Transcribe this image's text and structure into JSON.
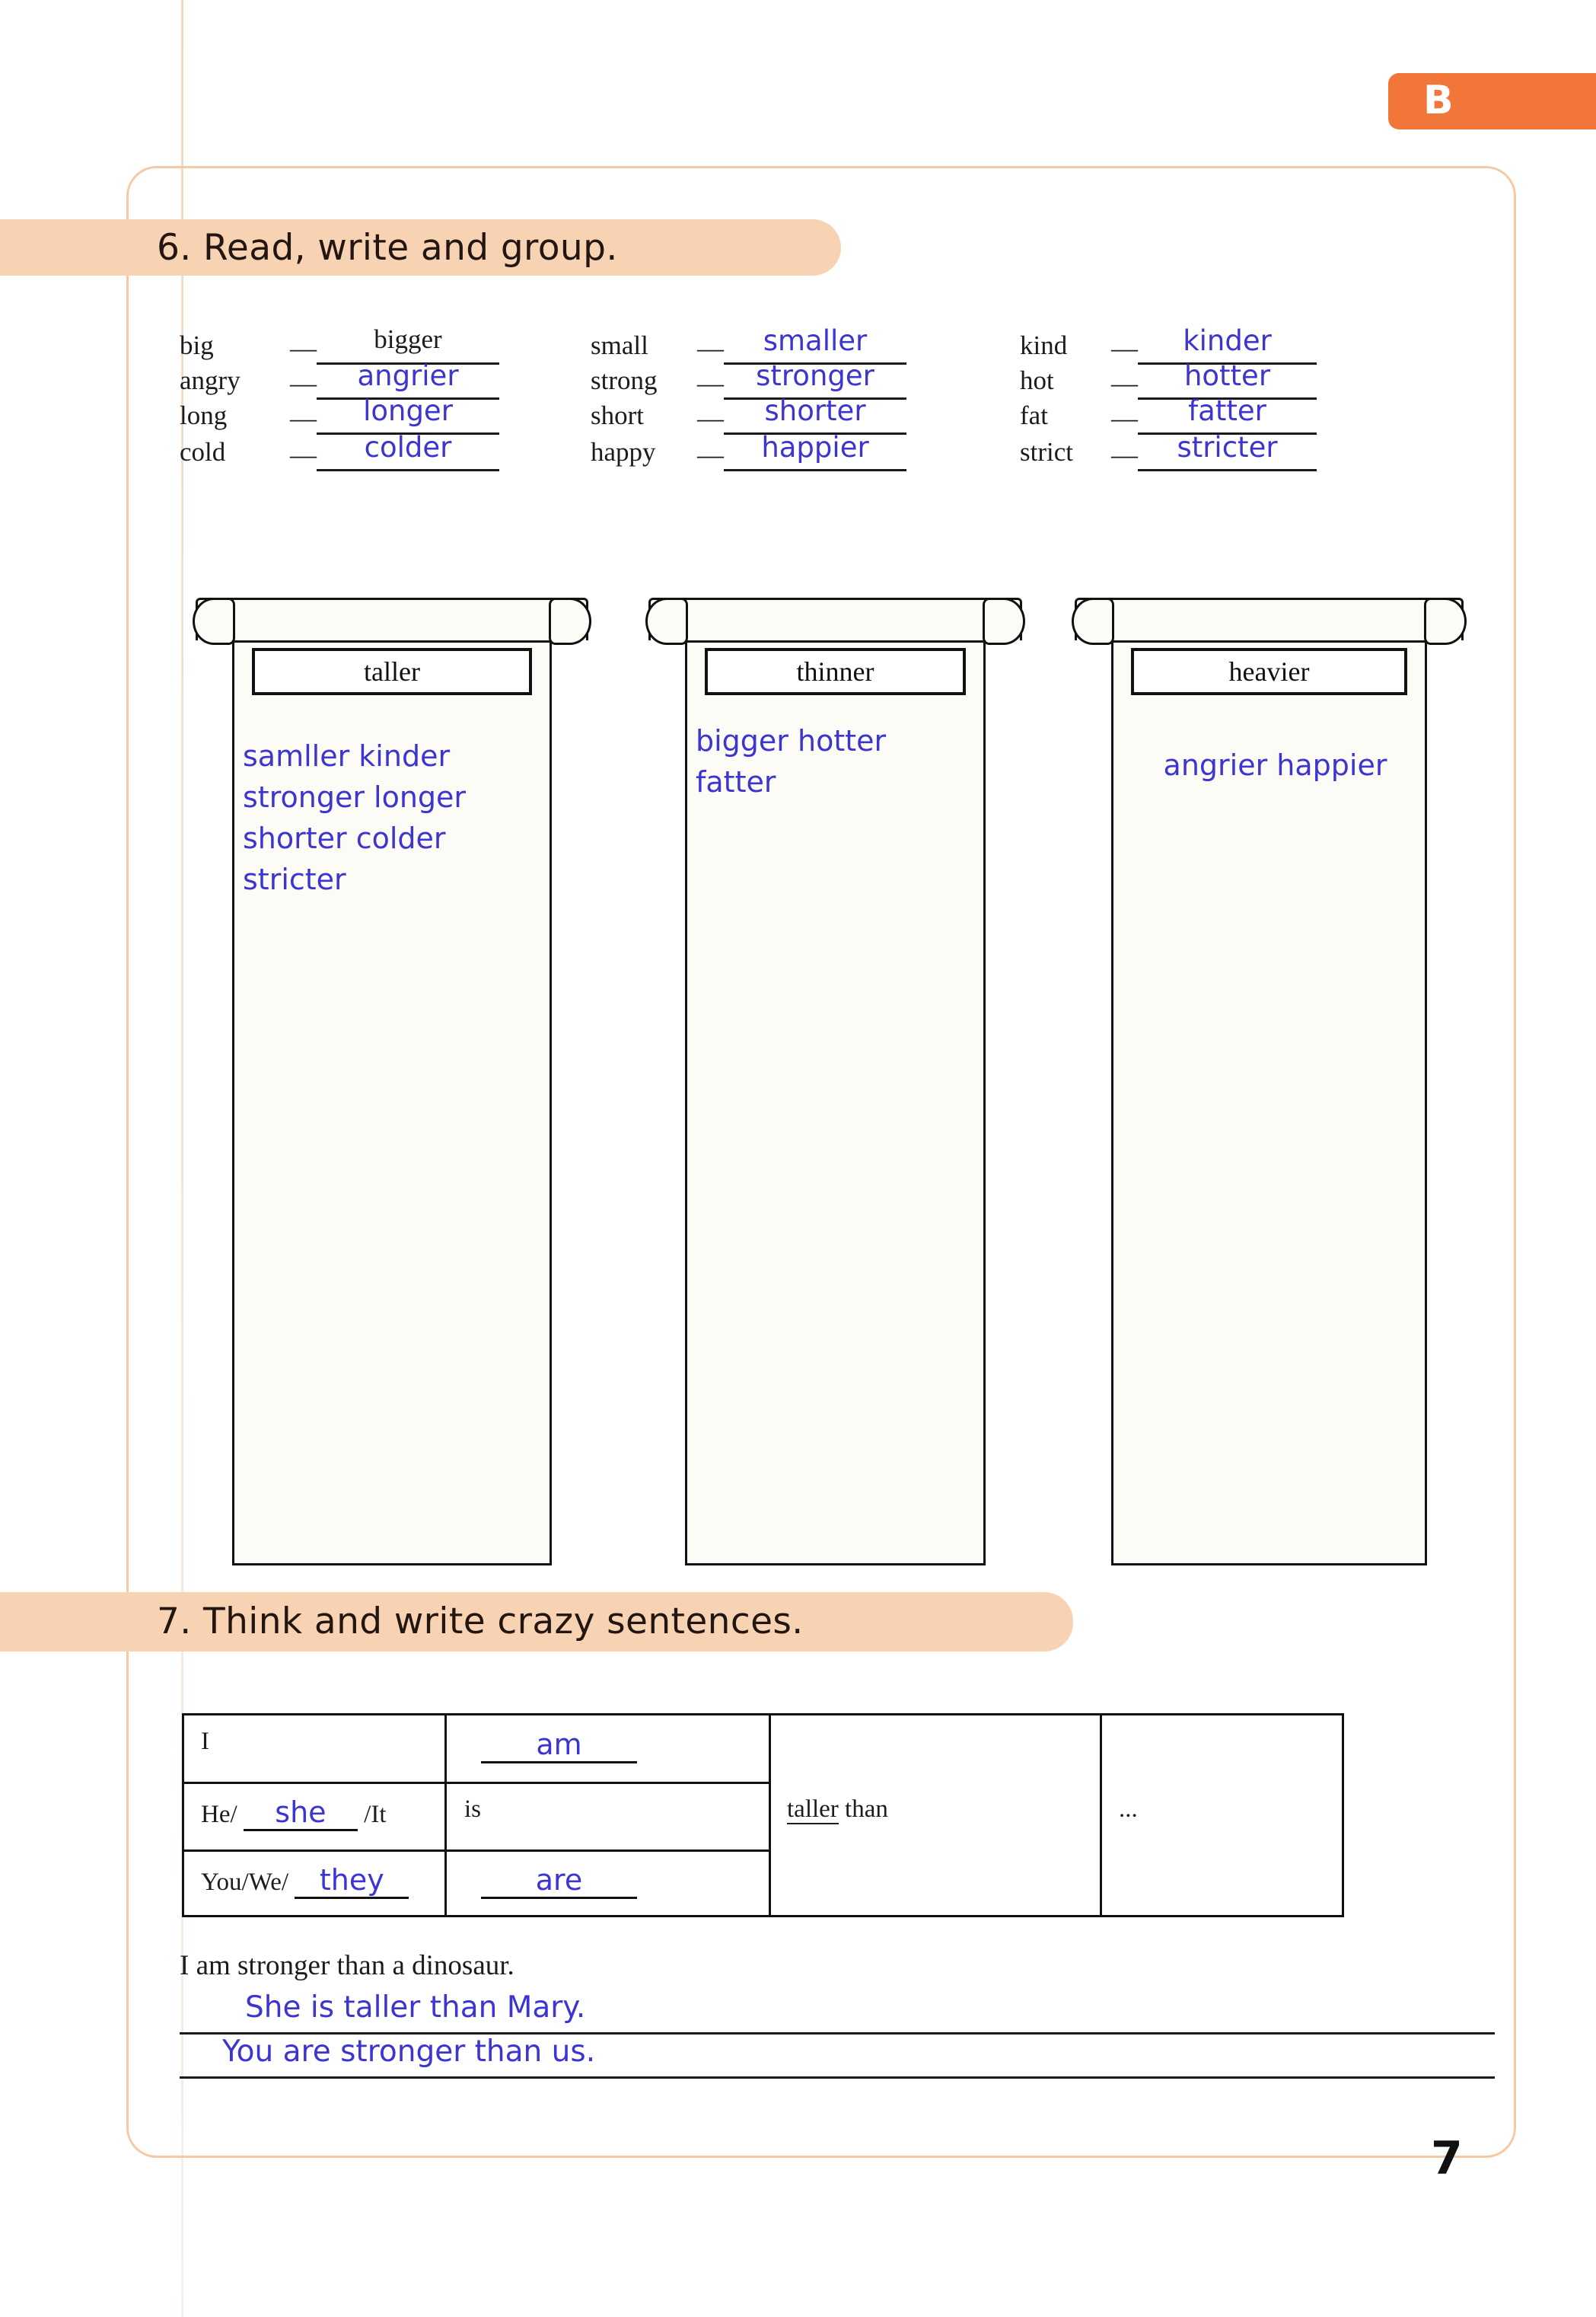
{
  "section_badge": {
    "label": "B"
  },
  "page_number": "7",
  "exercise6": {
    "heading": "6. Read, write and group.",
    "columns": [
      {
        "pairs": [
          {
            "base": "big",
            "dash": "—",
            "answer": "bigger",
            "printed": true
          },
          {
            "base": "angry",
            "dash": "—",
            "answer": "angrier",
            "printed": false
          },
          {
            "base": "long",
            "dash": "—",
            "answer": "longer",
            "printed": false
          },
          {
            "base": "cold",
            "dash": "—",
            "answer": "colder",
            "printed": false
          }
        ]
      },
      {
        "pairs": [
          {
            "base": "small",
            "dash": "—",
            "answer": "smaller",
            "printed": false
          },
          {
            "base": "strong",
            "dash": "—",
            "answer": "stronger",
            "printed": false
          },
          {
            "base": "short",
            "dash": "—",
            "answer": "shorter",
            "printed": false
          },
          {
            "base": "happy",
            "dash": "—",
            "answer": "happier",
            "printed": false
          }
        ]
      },
      {
        "pairs": [
          {
            "base": "kind",
            "dash": "—",
            "answer": "kinder",
            "printed": false
          },
          {
            "base": "hot",
            "dash": "—",
            "answer": "hotter",
            "printed": false
          },
          {
            "base": "fat",
            "dash": "—",
            "answer": "fatter",
            "printed": false
          },
          {
            "base": "strict",
            "dash": "—",
            "answer": "stricter",
            "printed": false
          }
        ]
      }
    ],
    "groups": [
      {
        "title": "taller",
        "lines": [
          "samller kinder",
          "stronger longer",
          "shorter colder",
          " stricter"
        ]
      },
      {
        "title": "thinner",
        "lines": [
          "bigger hotter",
          "fatter"
        ]
      },
      {
        "title": "heavier",
        "lines": [
          "angrier happier"
        ]
      }
    ]
  },
  "exercise7": {
    "heading": "7. Think and write crazy sentences.",
    "table": {
      "rows": [
        {
          "subject_prefix": "I",
          "subject_blank": "",
          "subject_suffix": "",
          "verb_prefix": "",
          "verb_blank": "am",
          "comparative": "",
          "tail": ""
        },
        {
          "subject_prefix": "He/",
          "subject_blank": "she",
          "subject_suffix": "/It",
          "verb_prefix": "is",
          "verb_blank": "",
          "comparative": "taller than",
          "tail": "..."
        },
        {
          "subject_prefix": "You/We/",
          "subject_blank": "they",
          "subject_suffix": "",
          "verb_prefix": "",
          "verb_blank": "are",
          "comparative": "",
          "tail": ""
        }
      ]
    },
    "example_sentence": "I am stronger than a dinosaur.",
    "written_sentences": [
      "She is taller than Mary.",
      "You are stronger than us."
    ]
  },
  "colors": {
    "badge_orange": "#f2763a",
    "band_peach": "#f7d3b4",
    "frame_orange": "#f4c9a3",
    "pen_blue": "#3c35d0",
    "print_black": "#1c1c1c"
  }
}
